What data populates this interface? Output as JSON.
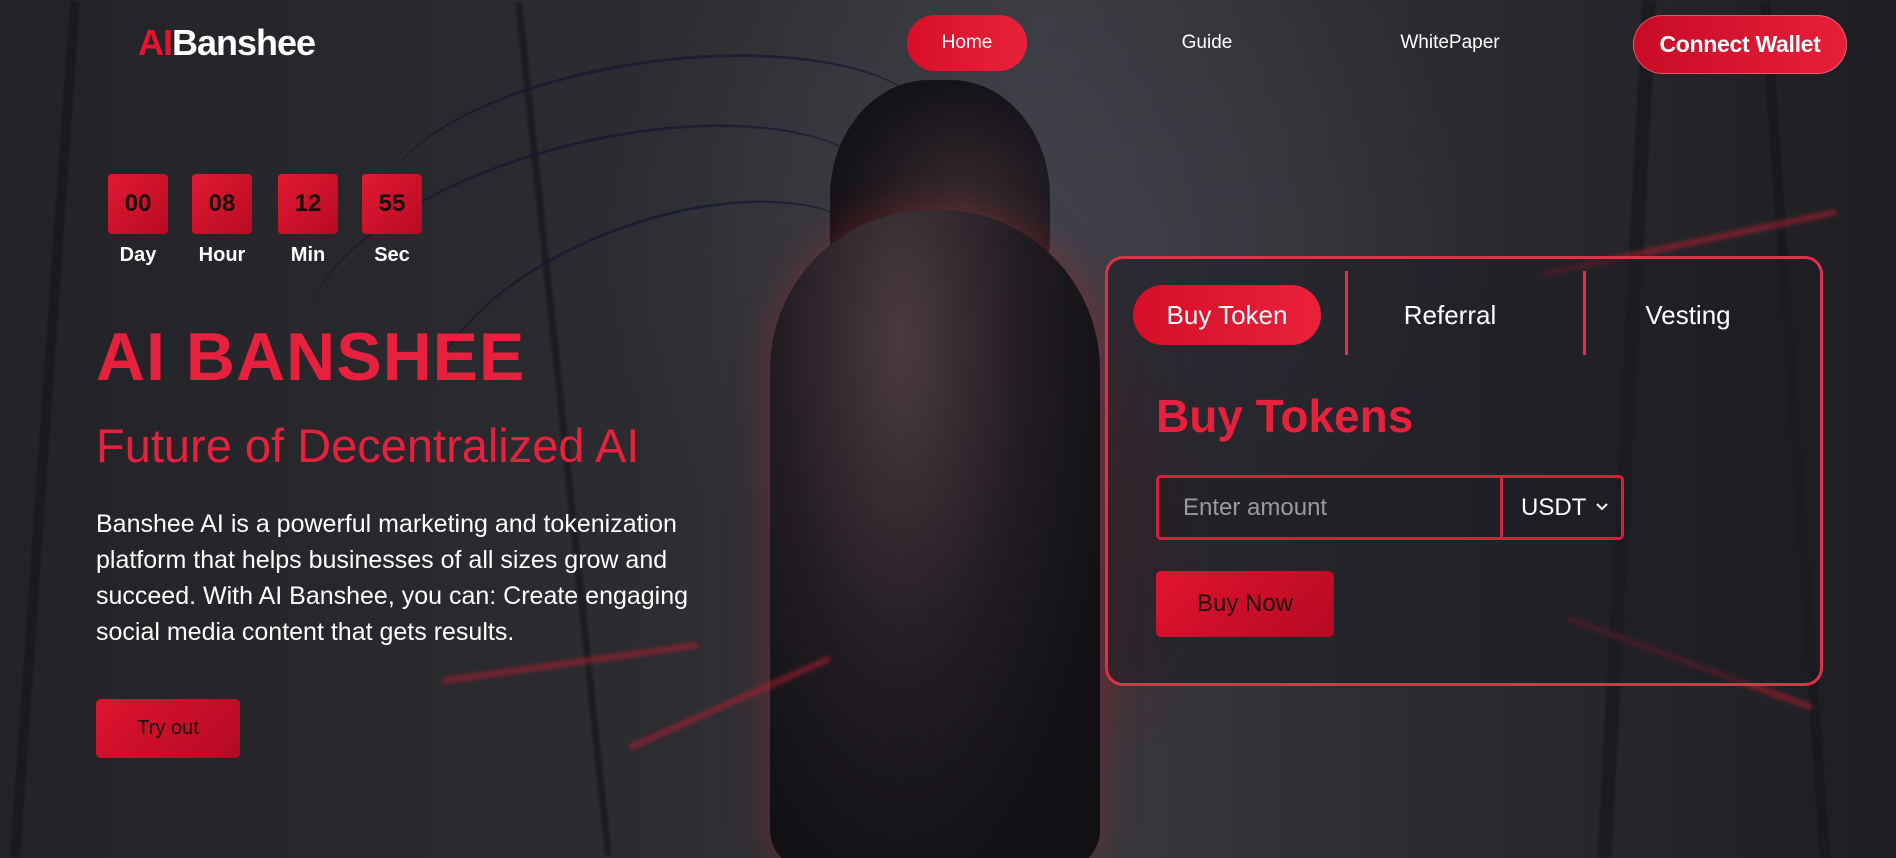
{
  "header": {
    "logo": {
      "prefix": "AI",
      "rest": "Banshee"
    },
    "nav": [
      {
        "label": "Home",
        "active": true
      },
      {
        "label": "Guide",
        "active": false
      },
      {
        "label": "WhitePaper",
        "active": false
      }
    ],
    "connect_label": "Connect Wallet"
  },
  "countdown": [
    {
      "value": "00",
      "label": "Day"
    },
    {
      "value": "08",
      "label": "Hour"
    },
    {
      "value": "12",
      "label": "Min"
    },
    {
      "value": "55",
      "label": "Sec"
    }
  ],
  "hero": {
    "title": "AI BANSHEE",
    "subtitle": "Future of Decentralized AI",
    "description": "Banshee AI is a powerful marketing and tokenization platform that helps businesses of all sizes grow and succeed. With AI Banshee, you can: Create engaging social media content that gets results.",
    "cta_label": "Try out"
  },
  "panel": {
    "tabs": [
      {
        "label": "Buy Token",
        "active": true
      },
      {
        "label": "Referral",
        "active": false
      },
      {
        "label": "Vesting",
        "active": false
      }
    ],
    "title": "Buy Tokens",
    "amount_value": "",
    "amount_placeholder": "Enter amount",
    "currency": "USDT",
    "buy_label": "Buy Now"
  },
  "colors": {
    "accent": "#e6203d",
    "button_red": "#d90f2a",
    "background": "#2a2a2f"
  },
  "icons": {
    "currency_dropdown": "chevron-down-icon"
  }
}
